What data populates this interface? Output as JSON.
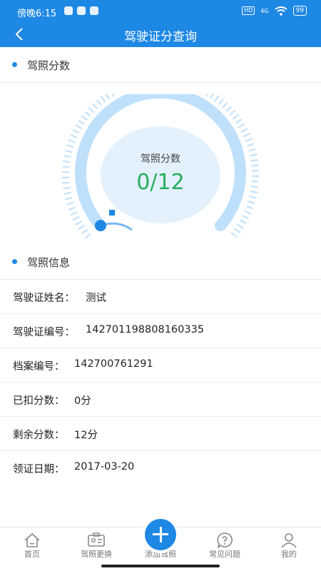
{
  "status": {
    "time": "傍晚6:15",
    "hd": "HD",
    "net": "4G",
    "battery": "99"
  },
  "header": {
    "title": "驾驶证分查询"
  },
  "score_section": {
    "title": "驾照分数"
  },
  "gauge": {
    "label": "驾照分数",
    "value_text": "0/12",
    "fraction": 0.0,
    "accent": "#27ae60"
  },
  "info_section": {
    "title": "驾照信息"
  },
  "info": [
    {
      "key": "驾驶证姓名：",
      "value": "测试"
    },
    {
      "key": "驾驶证编号：",
      "value": "142701198808160335"
    },
    {
      "key": "档案编号：",
      "value": "142700761291"
    },
    {
      "key": "已扣分数：",
      "value": "0分"
    },
    {
      "key": "剩余分数：",
      "value": "12分"
    },
    {
      "key": "领证日期：",
      "value": "2017-03-20"
    }
  ],
  "tabs": [
    {
      "label": "首页",
      "icon": "home-icon"
    },
    {
      "label": "驾照更换",
      "icon": "id-card-icon"
    },
    {
      "label": "添加驾照",
      "icon": "plus-icon"
    },
    {
      "label": "常见问题",
      "icon": "question-icon"
    },
    {
      "label": "我的",
      "icon": "user-icon"
    }
  ],
  "colors": {
    "primary": "#1e88e5",
    "score": "#27ae60"
  }
}
